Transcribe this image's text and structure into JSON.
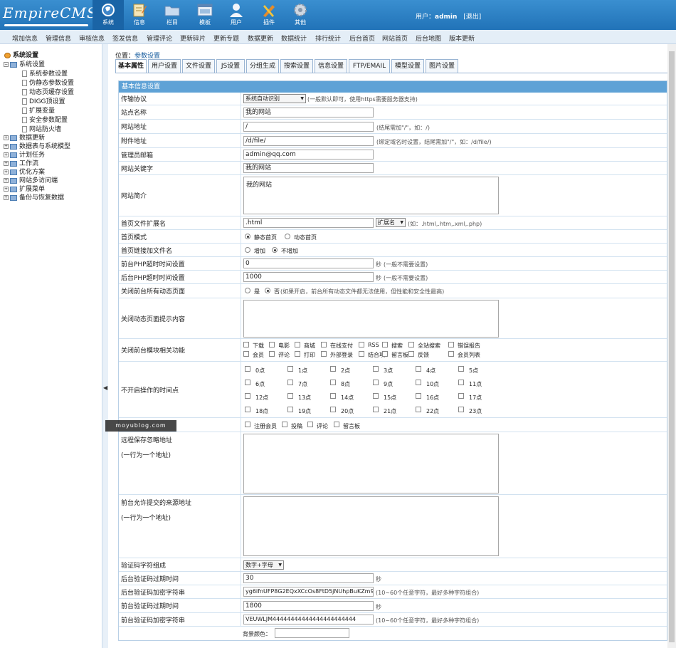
{
  "brand": {
    "logo_text": "EmpireCMS"
  },
  "topnav": [
    {
      "label": "系统",
      "icon": "globe-icon",
      "active": true
    },
    {
      "label": "信息",
      "icon": "edit-icon"
    },
    {
      "label": "栏目",
      "icon": "folder-icon"
    },
    {
      "label": "模板",
      "icon": "window-icon"
    },
    {
      "label": "用户",
      "icon": "user-icon"
    },
    {
      "label": "插件",
      "icon": "tools-icon"
    },
    {
      "label": "其他",
      "icon": "gear-icon"
    }
  ],
  "user": {
    "prefix": "用户：",
    "name": "admin",
    "logout": "[退出]"
  },
  "menubar": [
    "增加信息",
    "管理信息",
    "审核信息",
    "签发信息",
    "管理评论",
    "更新碎片",
    "更新专题",
    "数据更新",
    "数据统计",
    "排行统计",
    "后台首页",
    "网站首页",
    "后台地图",
    "版本更新"
  ],
  "sidebar": {
    "root": "系统设置",
    "group": "系统设置",
    "children": [
      "系统参数设置",
      "伪静态参数设置",
      "动态页缓存设置",
      "DIGG顶设置",
      "扩展变量",
      "安全参数配置",
      "网站防火墙"
    ],
    "groups": [
      "数据更新",
      "数据表与系统模型",
      "计划任务",
      "工作流",
      "优化方案",
      "网站多访问端",
      "扩展菜单",
      "备份与恢复数据"
    ]
  },
  "location": {
    "prefix": "位置：",
    "current": "参数设置"
  },
  "tabs": [
    "基本属性",
    "用户设置",
    "文件设置",
    "JS设置",
    "分组生成",
    "搜索设置",
    "信息设置",
    "FTP/EMAIL",
    "模型设置",
    "图片设置"
  ],
  "form": {
    "header": "基本信息设置",
    "protocol": {
      "label": "传输协议",
      "value": "系统自动识别",
      "note": "(一般默认即可，使用https需要服务器支持)"
    },
    "sitename": {
      "label": "站点名称",
      "value": "我的网站"
    },
    "siteurl": {
      "label": "网站地址",
      "value": "/",
      "note": "(结尾需加\"/\"，如：/)"
    },
    "fileurl": {
      "label": "附件地址",
      "value": "/d/file/",
      "note": "(绑定域名时设置，结尾需加\"/\"，如：/d/file/)"
    },
    "email": {
      "label": "管理员邮箱",
      "value": "admin@qq.com"
    },
    "keywords": {
      "label": "网站关键字",
      "value": "我的网站"
    },
    "intro": {
      "label": "网站简介",
      "value": "我的网站"
    },
    "indexext": {
      "label": "首页文件扩展名",
      "value": ".html",
      "select": "扩展名",
      "note": "(如：.html,.htm,.xml,.php)"
    },
    "indexmode": {
      "label": "首页模式",
      "opt1": "静态首页",
      "opt2": "动态首页"
    },
    "indexlink": {
      "label": "首页链接加文件名",
      "opt1": "增加",
      "opt2": "不增加"
    },
    "fronttimeout": {
      "label": "前台PHP超时时间设置",
      "value": "0",
      "unit": "秒",
      "note": "(一般不需要设置)"
    },
    "admintimeout": {
      "label": "后台PHP超时时间设置",
      "value": "1000",
      "unit": "秒",
      "note": "(一般不需要设置)"
    },
    "closedyn": {
      "label": "关闭前台所有动态页面",
      "opt1": "是",
      "opt2": "否",
      "note": "(如果开启，前台所有动态文件都无法使用，但性能和安全性最高)"
    },
    "closemsg": {
      "label": "关闭动态页面提示内容"
    },
    "closemods": {
      "label": "关闭前台模块相关功能",
      "row1": [
        "下载",
        "电影",
        "商城",
        "在线支付",
        "RSS",
        "搜索",
        "全站搜索",
        "错误报告"
      ],
      "row2": [
        "会员",
        "评论",
        "打印",
        "外部登录",
        "结合项",
        "留言板",
        "反馈",
        "会员列表"
      ]
    },
    "hours": {
      "label": "不开启操作的时间点",
      "items": [
        "0点",
        "1点",
        "2点",
        "3点",
        "4点",
        "5点",
        "6点",
        "7点",
        "8点",
        "9点",
        "10点",
        "11点",
        "12点",
        "13点",
        "14点",
        "15点",
        "16点",
        "17点",
        "18点",
        "19点",
        "20点",
        "21点",
        "22点",
        "23点"
      ]
    },
    "hourmods": {
      "items": [
        "注册会员",
        "投稿",
        "评论",
        "留言板"
      ]
    },
    "remotesave": {
      "label": "远程保存忽略地址",
      "sub": "(一行为一个地址)"
    },
    "allowsource": {
      "label": "前台允许提交的来源地址",
      "sub": "(一行为一个地址)"
    },
    "captcha": {
      "label": "验证码字符组成",
      "value": "数字+字母"
    },
    "admincaptchaexp": {
      "label": "后台验证码过期时间",
      "value": "30",
      "unit": "秒"
    },
    "admincaptchakey": {
      "label": "后台验证码加密字符串",
      "value": "yg6ifnUFP8G2EQxXCcOs8FtD5jNUhpBuKZm9",
      "note": "(10~60个任意字符，最好多种字符组合)"
    },
    "frontcaptchaexp": {
      "label": "前台验证码过期时间",
      "value": "1800",
      "unit": "秒"
    },
    "frontcaptchakey": {
      "label": "前台验证码加密字符串",
      "value": "VEUWLJM44444444444444444444444",
      "note": "(10~60个任意字符，最好多种字符组合)"
    },
    "bgcolor": {
      "label": "背景颜色："
    }
  },
  "watermark": "moyublog.com"
}
